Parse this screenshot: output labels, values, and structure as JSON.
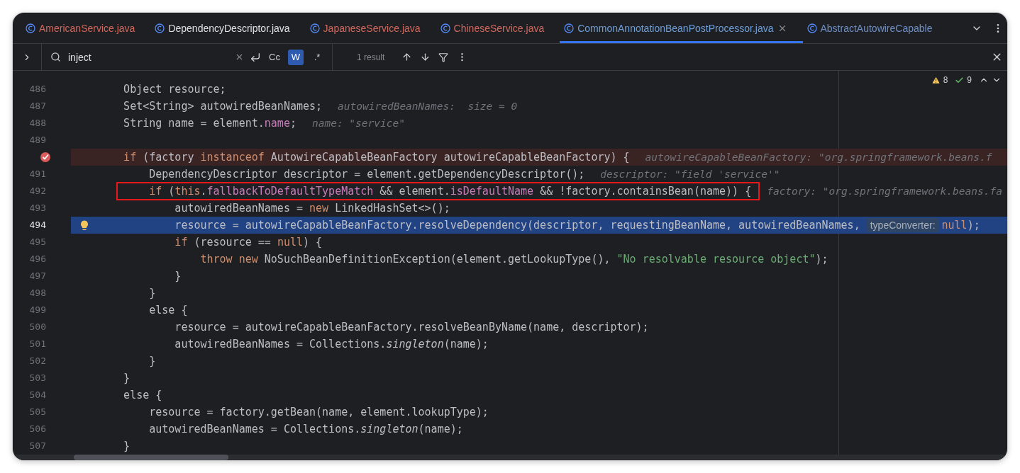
{
  "tabs": [
    {
      "label": "AmericanService.java",
      "color": "#d0685e",
      "selected": false
    },
    {
      "label": "DependencyDescriptor.java",
      "color": "#dfe1e5",
      "selected": false
    },
    {
      "label": "JapaneseService.java",
      "color": "#d0685e",
      "selected": false
    },
    {
      "label": "ChineseService.java",
      "color": "#d0685e",
      "selected": false
    },
    {
      "label": "CommonAnnotationBeanPostProcessor.java",
      "color": "#6f9fd8",
      "selected": true
    },
    {
      "label": "AbstractAutowireCapable",
      "color": "#6f8fc4",
      "selected": false
    }
  ],
  "search": {
    "value": "inject",
    "toggles": [
      {
        "label": "Cc",
        "selected": false
      },
      {
        "label": "W",
        "selected": true
      },
      {
        "label": ".*",
        "selected": false
      }
    ],
    "result": "1 result"
  },
  "inspections": {
    "warnings": "8",
    "typos": "9"
  },
  "lines": [
    {
      "number": "486",
      "kind": "normal",
      "marked": false,
      "tokens": [
        {
          "kind": "plain",
          "text": "    Object resource;"
        }
      ]
    },
    {
      "number": "487",
      "kind": "normal",
      "marked": false,
      "tokens": [
        {
          "kind": "plain",
          "text": "    Set<String> autowiredBeanNames;"
        }
      ],
      "hint": "autowiredBeanNames:  size = 0"
    },
    {
      "number": "488",
      "kind": "normal",
      "marked": false,
      "tokens": [
        {
          "kind": "plain",
          "text": "    String name = element."
        },
        {
          "kind": "field",
          "text": "name"
        },
        {
          "kind": "plain",
          "text": ";"
        }
      ],
      "hint": "name: \"service\""
    },
    {
      "number": "489",
      "kind": "normal",
      "marked": false
    },
    {
      "kind": "breakpoint",
      "marked": false,
      "tokens": [
        {
          "kind": "keyword",
          "text": "    if"
        },
        {
          "kind": "plain",
          "text": " (factory "
        },
        {
          "kind": "keyword",
          "text": "instanceof"
        },
        {
          "kind": "plain",
          "text": " AutowireCapableBeanFactory autowireCapableBeanFactory) {"
        }
      ],
      "hint": "autowireCapableBeanFactory: \"org.springframework.beans.f"
    },
    {
      "number": "491",
      "kind": "normal",
      "marked": false,
      "tokens": [
        {
          "kind": "plain",
          "text": "        DependencyDescriptor descriptor = element.getDependencyDescriptor();"
        }
      ],
      "hint": "descriptor: \"field 'service'\""
    },
    {
      "number": "492",
      "kind": "normal",
      "marked": true,
      "tokens": [
        {
          "kind": "keyword",
          "text": "        if"
        },
        {
          "kind": "plain",
          "text": " ("
        },
        {
          "kind": "keyword",
          "text": "this"
        },
        {
          "kind": "plain",
          "text": "."
        },
        {
          "kind": "field",
          "text": "fallbackToDefaultTypeMatch"
        },
        {
          "kind": "plain",
          "text": " && element."
        },
        {
          "kind": "field",
          "text": "isDefaultName"
        },
        {
          "kind": "plain",
          "text": " && !factory.containsBean(name)) {"
        }
      ],
      "hint": "factory: \"org.springframework.beans.fa"
    },
    {
      "number": "493",
      "kind": "normal",
      "marked": false,
      "tokens": [
        {
          "kind": "plain",
          "text": "            autowiredBeanNames = "
        },
        {
          "kind": "keyword",
          "text": "new"
        },
        {
          "kind": "plain",
          "text": " LinkedHashSet<>();"
        }
      ]
    },
    {
      "number": "494",
      "kind": "current",
      "marked": false,
      "tokens": [
        {
          "kind": "plain",
          "text": "            resource = autowireCapableBeanFactory.resolveDependency(descriptor, requestingBeanName, autowiredBeanNames, "
        },
        {
          "kind": "inlay",
          "text": "typeConverter:"
        },
        {
          "kind": "keyword",
          "text": "null"
        },
        {
          "kind": "plain",
          "text": ");"
        }
      ]
    },
    {
      "number": "495",
      "kind": "normal",
      "marked": false,
      "tokens": [
        {
          "kind": "keyword",
          "text": "            if"
        },
        {
          "kind": "plain",
          "text": " (resource == "
        },
        {
          "kind": "keyword",
          "text": "null"
        },
        {
          "kind": "plain",
          "text": ") {"
        }
      ]
    },
    {
      "number": "496",
      "kind": "normal",
      "marked": false,
      "tokens": [
        {
          "kind": "keyword",
          "text": "                throw new"
        },
        {
          "kind": "plain",
          "text": " NoSuchBeanDefinitionException(element.getLookupType(), "
        },
        {
          "kind": "string",
          "text": "\"No resolvable resource object\""
        },
        {
          "kind": "plain",
          "text": ");"
        }
      ]
    },
    {
      "number": "497",
      "kind": "normal",
      "marked": false,
      "tokens": [
        {
          "kind": "plain",
          "text": "            }"
        }
      ]
    },
    {
      "number": "498",
      "kind": "normal",
      "marked": false,
      "tokens": [
        {
          "kind": "plain",
          "text": "        }"
        }
      ]
    },
    {
      "number": "499",
      "kind": "normal",
      "marked": false,
      "tokens": [
        {
          "kind": "plain",
          "text": "        else {"
        }
      ]
    },
    {
      "number": "500",
      "kind": "normal",
      "marked": false,
      "tokens": [
        {
          "kind": "plain",
          "text": "            resource = autowireCapableBeanFactory.resolveBeanByName(name, descriptor);"
        }
      ]
    },
    {
      "number": "501",
      "kind": "normal",
      "marked": false,
      "tokens": [
        {
          "kind": "plain",
          "text": "            autowiredBeanNames = Collections."
        },
        {
          "kind": "static",
          "text": "singleton"
        },
        {
          "kind": "plain",
          "text": "(name);"
        }
      ]
    },
    {
      "number": "502",
      "kind": "normal",
      "marked": false,
      "tokens": [
        {
          "kind": "plain",
          "text": "        }"
        }
      ]
    },
    {
      "number": "503",
      "kind": "normal",
      "marked": false,
      "tokens": [
        {
          "kind": "plain",
          "text": "    }"
        }
      ]
    },
    {
      "number": "504",
      "kind": "normal",
      "marked": false,
      "tokens": [
        {
          "kind": "plain",
          "text": "    else {"
        }
      ]
    },
    {
      "number": "505",
      "kind": "normal",
      "marked": false,
      "tokens": [
        {
          "kind": "plain",
          "text": "        resource = factory.getBean(name, element.lookupType);"
        }
      ]
    },
    {
      "number": "506",
      "kind": "normal",
      "marked": false,
      "tokens": [
        {
          "kind": "plain",
          "text": "        autowiredBeanNames = Collections."
        },
        {
          "kind": "static",
          "text": "singleton"
        },
        {
          "kind": "plain",
          "text": "(name);"
        }
      ]
    },
    {
      "number": "507",
      "kind": "normal",
      "marked": false,
      "tokens": [
        {
          "kind": "plain",
          "text": "    }"
        }
      ]
    }
  ]
}
